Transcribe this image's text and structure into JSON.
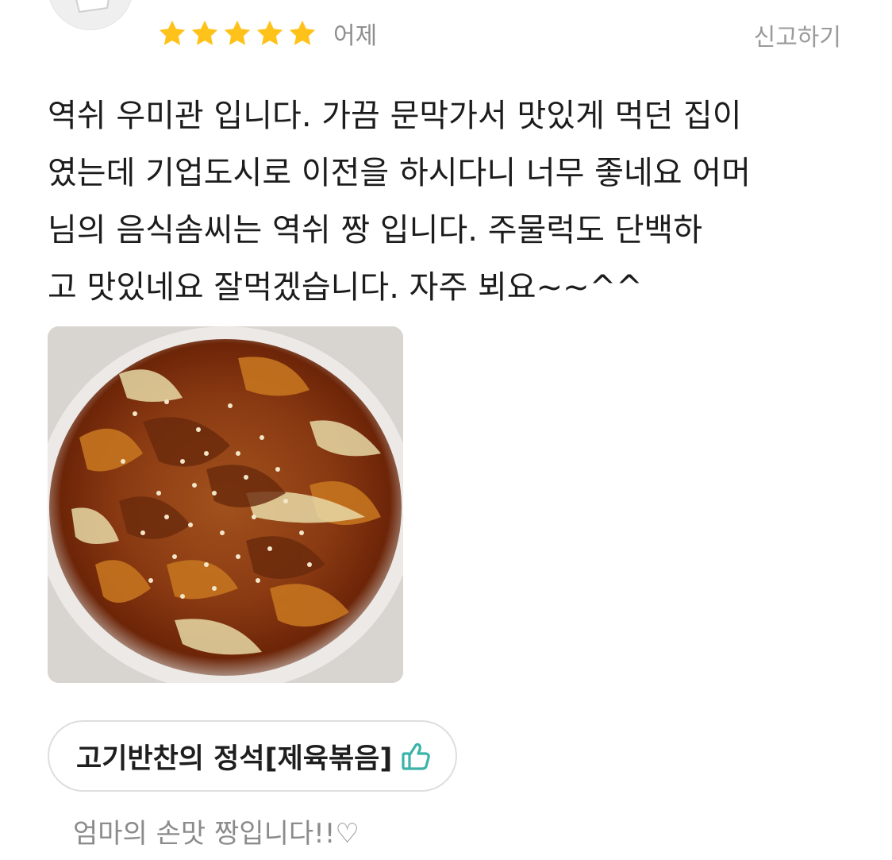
{
  "review": {
    "rating": 5,
    "rating_max": 5,
    "date": "어제",
    "report_label": "신고하기",
    "text": "역쉬 우미관 입니다.  가끔 문막가서  맛있게 먹던 집이\n였는데 기업도시로 이전을 하시다니 너무 좋네요  어머\n님의 음식솜씨는 역쉬 짱 입니다. 주물럭도 단백하\n고  맛있네요  잘먹겠습니다. 자주 뵈요~~^^",
    "photo_icon": "food-photo",
    "menu_tag": {
      "name": "고기반찬의 정석[제육볶음]",
      "icon": "thumbs-up-icon",
      "icon_color": "#3bb3a9"
    },
    "reply_preview": "엄마의 손맛 짱입니다!!♡"
  },
  "colors": {
    "star": "#ffc21a",
    "meta_text": "#8e8e8e",
    "accent": "#3bb3a9"
  }
}
